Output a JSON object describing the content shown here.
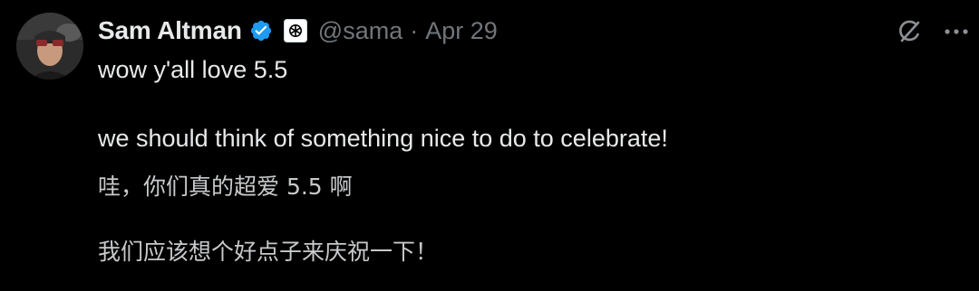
{
  "author": {
    "display_name": "Sam Altman",
    "handle": "@sama",
    "separator": "·",
    "date": "Apr 29"
  },
  "tweet": {
    "line1": "wow y'all love 5.5",
    "line2": "we should think of something nice to do to celebrate!"
  },
  "translation": {
    "line1": "哇，你们真的超爱 5.5 啊",
    "line2": "我们应该想个好点子来庆祝一下！"
  },
  "icons": {
    "verified": "verified-badge-icon",
    "affiliation": "openai-logo-icon",
    "grok": "grok-icon",
    "more": "more-options-icon"
  },
  "colors": {
    "background": "#000000",
    "text": "#e7e9ea",
    "muted": "#71767b",
    "verified": "#1d9bf0"
  }
}
